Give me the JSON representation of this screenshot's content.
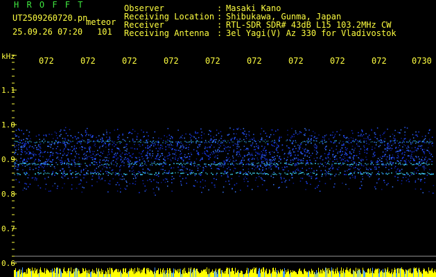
{
  "header": {
    "logo_text": "H R O F F T",
    "file_name": "UT2509260720.pn",
    "mode": "meteor",
    "datetime": "25.09.26 07:20",
    "count": "101",
    "fields": [
      {
        "label": "Observer",
        "value": "Masaki Kano"
      },
      {
        "label": "Receiving Location",
        "value": "Shibukawa, Gunma, Japan"
      },
      {
        "label": "Receiver",
        "value": "RTL-SDR SDR# 43dB L15 103.2MHz CW"
      },
      {
        "label": "Receiving Antenna",
        "value": "3el Yagi(V) Az 330 for Vladivostok"
      }
    ]
  },
  "x_axis": {
    "labels": [
      "072",
      "072",
      "072",
      "072",
      "072",
      "072",
      "072",
      "072",
      "072",
      "0730"
    ]
  },
  "y_axis": {
    "unit": "kHz",
    "labels": [
      "1.1",
      "1.0",
      "0.9",
      "0.8",
      "0.7",
      "0.6"
    ]
  },
  "colors": {
    "text_yellow": "#ffff40",
    "text_green": "#3fe83f",
    "noise_band": "#1a3cff",
    "echo_line": "#40e0ff",
    "bottom_bar": "#ffff00"
  }
}
